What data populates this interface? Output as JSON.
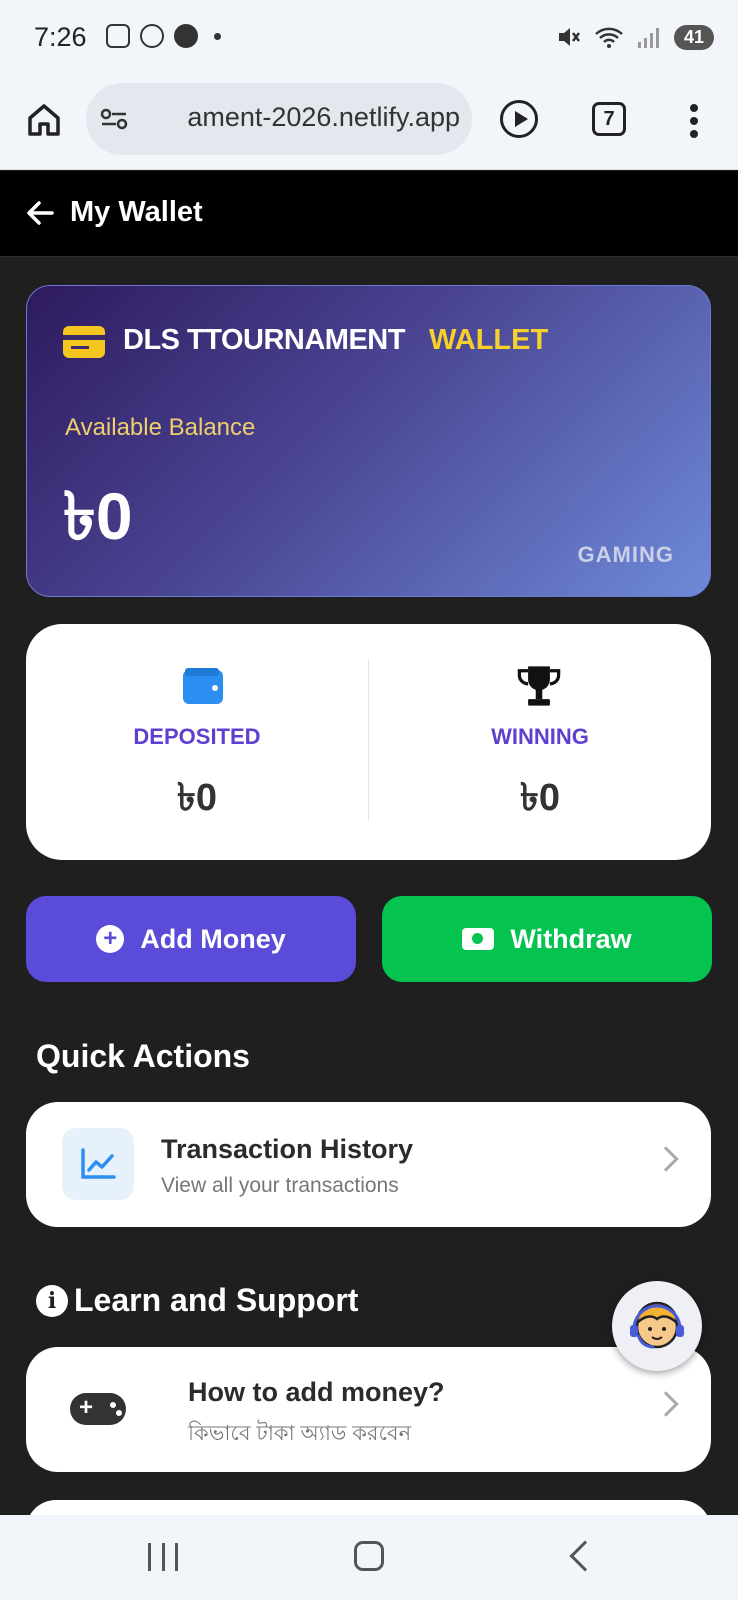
{
  "status_bar": {
    "time": "7:26",
    "battery": "41"
  },
  "browser": {
    "url": "ament-2026.netlify.app",
    "tab_count": "7"
  },
  "header": {
    "title": "My Wallet"
  },
  "wallet_card": {
    "brand": "DLS TTOURNAMENT",
    "brand_accent": "WALLET",
    "balance_label": "Available Balance",
    "balance": "৳0",
    "tag": "GAMING"
  },
  "stats": {
    "deposited": {
      "label": "DEPOSITED",
      "value": "৳0"
    },
    "winning": {
      "label": "WINNING",
      "value": "৳0"
    }
  },
  "actions": {
    "add_money": "Add Money",
    "withdraw": "Withdraw"
  },
  "quick_actions": {
    "title": "Quick Actions",
    "items": [
      {
        "title": "Transaction History",
        "subtitle": "View all your transactions"
      }
    ]
  },
  "learn_support": {
    "title": "Learn and Support",
    "items": [
      {
        "title": "How to add money?",
        "subtitle": "কিভাবে টাকা অ্যাড করবেন"
      }
    ]
  },
  "colors": {
    "accent_purple": "#5a4bd8",
    "accent_green": "#04c44f",
    "brand_yellow": "#f7d02b",
    "background": "#1f1f1f"
  },
  "icons": {
    "wallet_card": "credit-card-icon",
    "deposited": "wallet-icon",
    "winning": "trophy-icon",
    "add_money": "plus-circle-icon",
    "withdraw": "cash-icon",
    "transaction_history": "chart-line-icon",
    "how_to_add": "gamepad-icon",
    "support": "support-agent-icon"
  }
}
